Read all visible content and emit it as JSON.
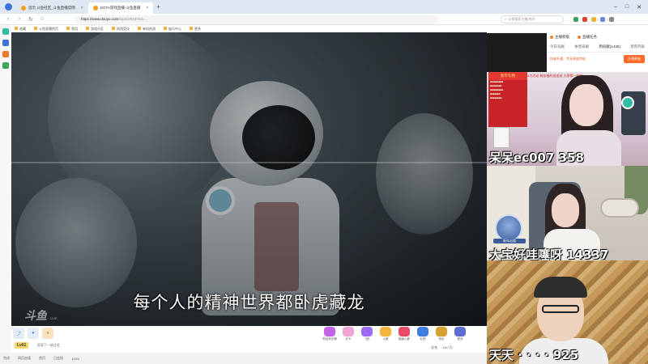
{
  "browser": {
    "tabs": [
      {
        "label": "首页 斗鱼社区_斗鱼直播官网",
        "active": false
      },
      {
        "label": "DOTA游戏直播-斗鱼直播",
        "active": true
      }
    ],
    "url_host": "https://www.douyu.com",
    "url_path": "/topic/2023?rid=...",
    "search_placeholder": "斗鱼搜索主播/房间",
    "bookmarks": [
      "收藏",
      "斗鱼直播首页",
      "常用",
      "游戏分区",
      "网游竞技",
      "单机热游",
      "娱乐中心",
      "更多"
    ]
  },
  "video": {
    "subtitle": "每个人的精神世界都卧虎藏龙",
    "watermark": "斗鱼",
    "watermark_sub": "LIVE"
  },
  "player_bar": {
    "level": "Lv61",
    "level_info": "距离下一级还差",
    "gifts": [
      "粉丝荧光棒",
      "办卡",
      "飞机",
      "火箭",
      "超级火箭",
      "礼物",
      "背包",
      "更多"
    ],
    "stats_left": "总充",
    "stats_right": "1417万"
  },
  "status_bar": [
    "完成",
    "网页加速",
    "首页",
    "已连接",
    "100%"
  ],
  "right_panel": {
    "header": [
      "主播积极",
      "直播任务"
    ],
    "tabs": [
      "今日贡献",
      "本周贡献",
      "周贡献(1425)",
      "贵宾列表"
    ],
    "notice": "快来开通，专享贵族特权",
    "notice_btn": "开通贵族"
  },
  "cams": [
    {
      "caption": "呆呆ec007 358",
      "poster_title": "新年礼物",
      "banner": "4月活动 粉丝福利送送送 大家都一起来"
    },
    {
      "caption": "大宝好哇噻呀 14337",
      "badge": "新年出道"
    },
    {
      "caption": "天天 · · · · 925"
    }
  ]
}
